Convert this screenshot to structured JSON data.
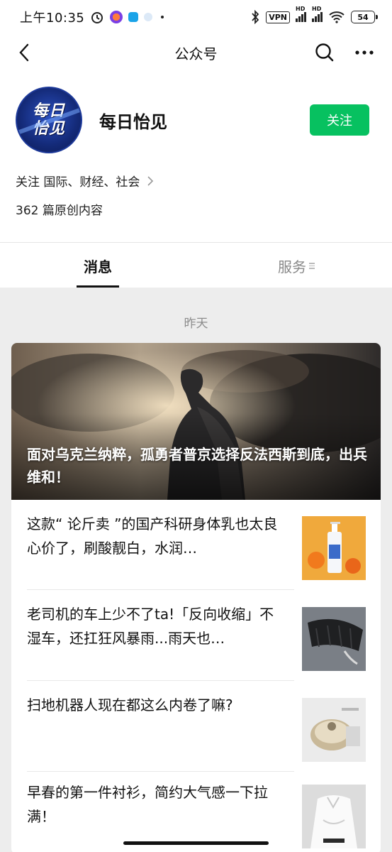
{
  "status_bar": {
    "time": "上午10:35",
    "vpn": "VPN",
    "network_1": "HD",
    "network_2": "HD",
    "battery": "54"
  },
  "nav": {
    "title": "公众号"
  },
  "profile": {
    "avatar_line1": "每日",
    "avatar_line2": "怡见",
    "name": "每日怡见",
    "follow_label": "关注",
    "tags": "关注 国际、财经、社会",
    "original_count": "362 篇原创内容"
  },
  "tabs": {
    "messages": "消息",
    "services": "服务"
  },
  "feed": {
    "date_label": "昨天",
    "hero_title": "面对乌克兰纳粹，孤勇者普京选择反法西斯到底，出兵维和！",
    "articles": [
      {
        "title": "这款“ 论斤卖 ”的国产科研身体乳也太良心价了，刷酸靓白，水润…",
        "thumb": "lotion-bottle-thumbnail"
      },
      {
        "title": "老司机的车上少不了ta!「反向收缩」不湿车，还扛狂风暴雨...雨天也…",
        "thumb": "umbrella-thumbnail"
      },
      {
        "title": "扫地机器人现在都这么内卷了嘛?",
        "thumb": "robot-vacuum-thumbnail"
      },
      {
        "title": "早春的第一件衬衫，简约大气感一下拉满！",
        "thumb": "white-shirt-thumbnail"
      }
    ]
  },
  "colors": {
    "accent_green": "#07c160",
    "feed_background": "#ededed"
  }
}
